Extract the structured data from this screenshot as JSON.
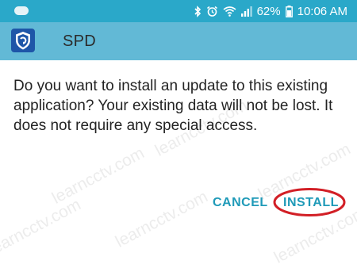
{
  "status_bar": {
    "left_icon_label": "",
    "battery_percent": "62%",
    "time": "10:06 AM",
    "icons": [
      "bluetooth-icon",
      "alarm-icon",
      "wifi-icon",
      "signal-icon",
      "battery-icon"
    ]
  },
  "app_bar": {
    "title": "SPD",
    "icon": "shield-app-icon"
  },
  "dialog": {
    "message": "Do you want to install an update to this existing application? Your existing data will not be lost. It does not require any special access.",
    "cancel_label": "CANCEL",
    "install_label": "INSTALL"
  },
  "watermark": "learncctv.com",
  "colors": {
    "status_bar": "#2aa8c9",
    "app_bar": "#62b9d6",
    "button_text": "#1f9ab8",
    "highlight_circle": "#d21f26"
  }
}
